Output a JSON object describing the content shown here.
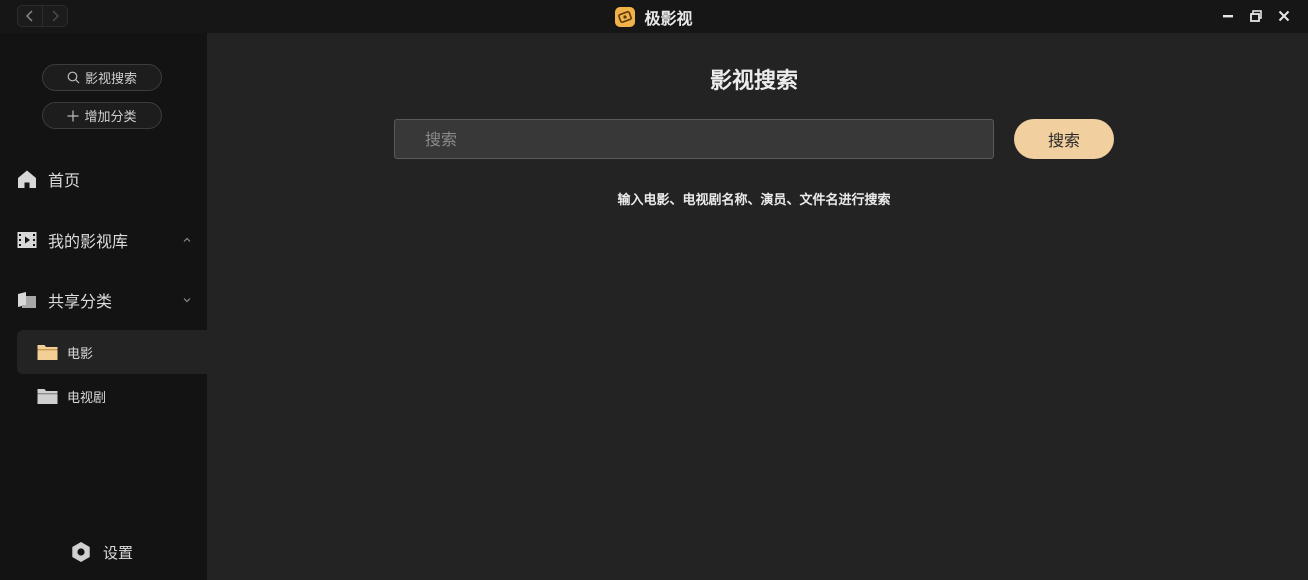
{
  "window": {
    "title": "极影视",
    "accent": "#f2b24a"
  },
  "titlebar": {
    "back_icon": "chevron-left-icon",
    "forward_icon": "chevron-right-icon",
    "controls": [
      "minimize-icon",
      "restore-icon",
      "close-icon"
    ]
  },
  "sidebar": {
    "search_button": "影视搜索",
    "add_category_button": "增加分类",
    "items": [
      {
        "label": "首页",
        "icon": "home-icon"
      },
      {
        "label": "我的影视库",
        "icon": "film-icon",
        "expanded": true
      },
      {
        "label": "共享分类",
        "icon": "share-folder-icon",
        "expanded": false
      }
    ],
    "shared_categories": [
      {
        "label": "电影",
        "active": true
      },
      {
        "label": "电视剧",
        "active": false
      }
    ],
    "settings_label": "设置"
  },
  "main": {
    "title": "影视搜索",
    "search_placeholder": "搜索",
    "search_value": "",
    "search_button": "搜索",
    "hint": "输入电影、电视剧名称、演员、文件名进行搜索",
    "button_color": "#f1cf9e"
  }
}
